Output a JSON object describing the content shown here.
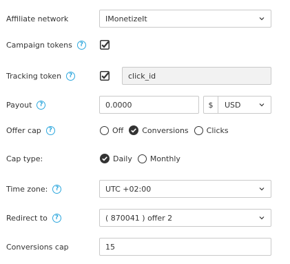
{
  "affiliate_network": {
    "label": "Affiliate network",
    "value": "IMonetizeIt"
  },
  "campaign_tokens": {
    "label": "Campaign tokens",
    "help": "?",
    "checked": true
  },
  "tracking_token": {
    "label": "Tracking token",
    "help": "?",
    "checked": true,
    "value": "click_id"
  },
  "payout": {
    "label": "Payout",
    "help": "?",
    "value": "0.0000",
    "currency_symbol": "$",
    "currency": "USD"
  },
  "offer_cap": {
    "label": "Offer cap",
    "help": "?",
    "options": [
      {
        "label": "Off",
        "selected": false
      },
      {
        "label": "Conversions",
        "selected": true
      },
      {
        "label": "Clicks",
        "selected": false
      }
    ]
  },
  "cap_type": {
    "label": "Cap type:",
    "options": [
      {
        "label": "Daily",
        "selected": true
      },
      {
        "label": "Monthly",
        "selected": false
      }
    ]
  },
  "time_zone": {
    "label": "Time zone:",
    "help": "?",
    "value": "UTC +02:00"
  },
  "redirect_to": {
    "label": "Redirect to",
    "help": "?",
    "value": "( 870041 ) offer 2"
  },
  "conversions_cap": {
    "label": "Conversions cap",
    "value": "15"
  },
  "colors": {
    "help_blue": "#2ba6dd",
    "border": "#c9c9c9",
    "text": "#333333"
  }
}
